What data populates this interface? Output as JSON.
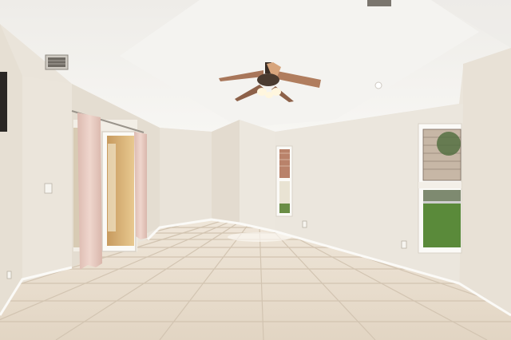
{
  "scene": {
    "kind": "empty-room-interior",
    "colors": {
      "ceiling": "#f1efeb",
      "wall": "#e9e3d9",
      "wall_shadow": "#ddd5c8",
      "floor_tile": "#e7dccd",
      "grout": "#cfc1ae",
      "baseboard": "#fbfaf7",
      "curtain": "#e6c9c0",
      "fan_blade": "#a8765a",
      "lawn": "#5a8a3a"
    },
    "icons": [
      "ceiling-fan-icon",
      "air-vent-icon",
      "window-icon",
      "sliding-door-icon",
      "curtain-icon",
      "light-switch-icon",
      "outlet-icon",
      "recessed-light-icon"
    ]
  }
}
